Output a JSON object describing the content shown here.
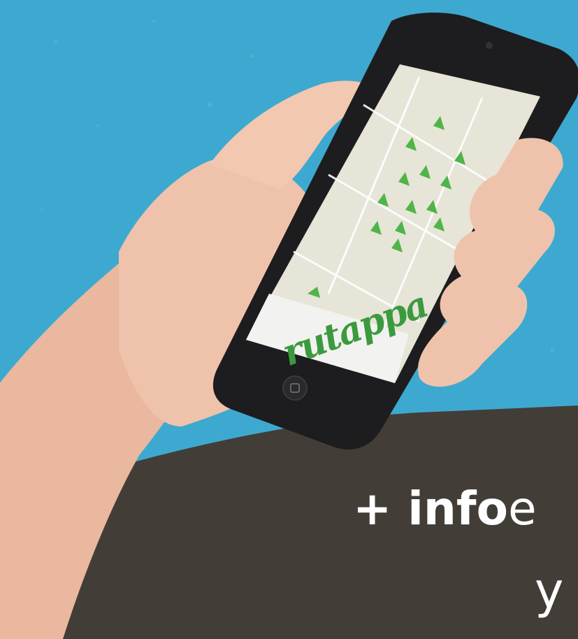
{
  "scene": {
    "background_color": "#3ea9d0",
    "panel_color": "#433d38",
    "skin_color": "#efc3ab",
    "phone_color": "#1d1d1f",
    "map_color": "#e7e4d8",
    "marker_color": "#4fb548"
  },
  "app": {
    "brand_name": "rutappa"
  },
  "caption": {
    "line1_bold": "+ info",
    "line1_rest": "e",
    "line2": "y"
  }
}
